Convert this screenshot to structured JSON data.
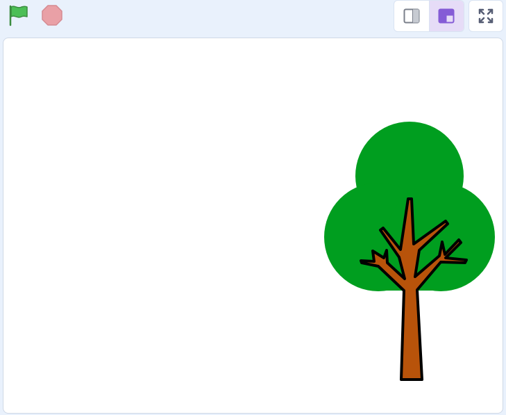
{
  "toolbar": {
    "green_flag": {
      "icon": "green-flag-icon",
      "color": "#4cbf56"
    },
    "stop": {
      "icon": "stop-sign-icon",
      "color": "#e9a0a6"
    },
    "layout_modes": [
      {
        "name": "small-stage-mode",
        "icon": "small-stage-icon",
        "active": false
      },
      {
        "name": "normal-stage-mode",
        "icon": "normal-stage-icon",
        "active": true
      }
    ],
    "fullscreen": {
      "icon": "fullscreen-icon"
    }
  },
  "stage": {
    "sprite": {
      "name": "tree-sprite",
      "colors": {
        "foliage": "#009e1f",
        "trunk": "#b8530a",
        "outline": "#000000"
      }
    }
  },
  "colors": {
    "accent": "#855cd6",
    "background": "#e9f1fc"
  }
}
